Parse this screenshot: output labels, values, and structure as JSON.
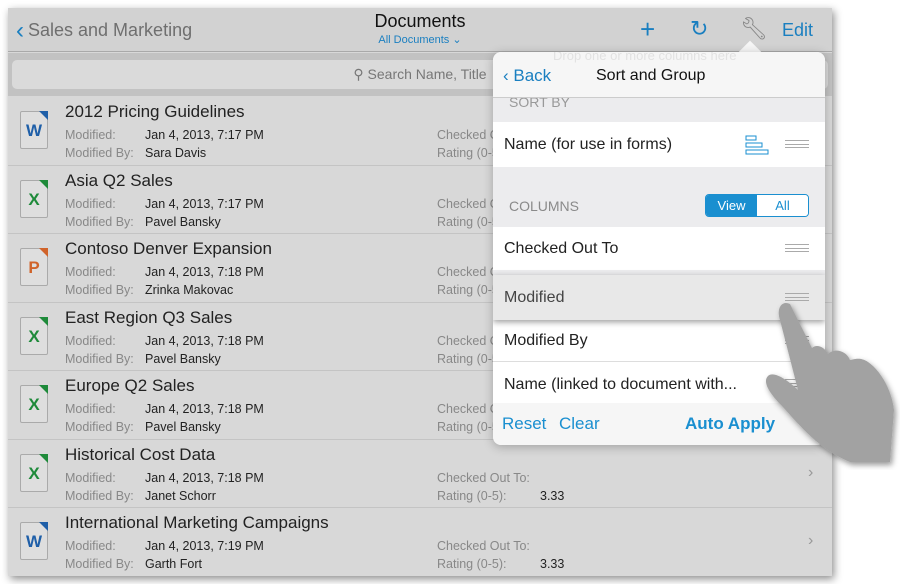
{
  "header": {
    "back_label": "Sales and Marketing",
    "title": "Documents",
    "subtitle": "All Documents",
    "subtitle_icon": "chevron-down-icon",
    "edit_label": "Edit",
    "icons": [
      "plus-icon",
      "refresh-icon",
      "wrench-icon"
    ]
  },
  "search": {
    "placeholder": "Search Name, Title"
  },
  "labels": {
    "modified": "Modified:",
    "modified_by": "Modified By:",
    "checked_out": "Checked Out To:",
    "rating": "Rating (0-5):"
  },
  "documents": [
    {
      "name": "2012 Pricing Guidelines",
      "type": "W",
      "modified": "Jan 4, 2013, 7:17 PM",
      "modified_by": "Sara Davis"
    },
    {
      "name": "Asia Q2 Sales",
      "type": "X",
      "modified": "Jan 4, 2013, 7:17 PM",
      "modified_by": "Pavel Bansky"
    },
    {
      "name": "Contoso Denver Expansion",
      "type": "P",
      "modified": "Jan 4, 2013, 7:18 PM",
      "modified_by": "Zrinka Makovac"
    },
    {
      "name": "East Region Q3 Sales",
      "type": "X",
      "modified": "Jan 4, 2013, 7:18 PM",
      "modified_by": "Pavel Bansky"
    },
    {
      "name": "Europe Q2 Sales",
      "type": "X",
      "modified": "Jan 4, 2013, 7:18 PM",
      "modified_by": "Pavel Bansky"
    },
    {
      "name": "Historical Cost Data",
      "type": "X",
      "modified": "Jan 4, 2013, 7:18 PM",
      "modified_by": "Janet Schorr",
      "rating": "3.33"
    },
    {
      "name": "International Marketing Campaigns",
      "type": "W",
      "modified": "Jan 4, 2013, 7:19 PM",
      "modified_by": "Garth Fort",
      "rating": "3.33"
    }
  ],
  "popover": {
    "drop_hint": "Drop one or more columns here",
    "back_label": "Back",
    "title": "Sort and Group",
    "sort_by_label": "SORT BY",
    "sort_item": "Name (for use in forms)",
    "columns_label": "COLUMNS",
    "view_label": "View",
    "all_label": "All",
    "columns": [
      "Checked Out To",
      "Modified",
      "Modified By",
      "Name (linked to document with..."
    ],
    "reset_label": "Reset",
    "clear_label": "Clear",
    "auto_apply_label": "Auto Apply"
  },
  "colors": {
    "accent": "#1a7fc0",
    "word": "#1f5fa8",
    "excel": "#1e8a3a",
    "powerpoint": "#d0632a"
  }
}
